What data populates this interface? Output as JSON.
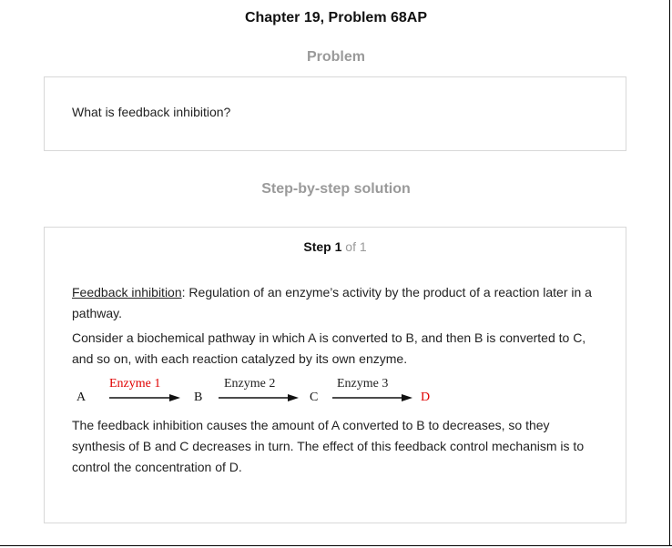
{
  "header": {
    "title": "Chapter 19, Problem 68AP"
  },
  "problem": {
    "heading": "Problem",
    "text": "What is feedback inhibition?"
  },
  "solution": {
    "heading": "Step-by-step solution",
    "step": {
      "word": "Step",
      "number": "1",
      "of_text": "of 1"
    },
    "para1": {
      "term": "Feedback inhibition",
      "rest": ": Regulation of an enzyme’s activity by the product of a reaction later in a pathway."
    },
    "para2": "Consider a biochemical pathway in which A is converted to B, and then B is converted to C, and so on, with each reaction catalyzed by its own enzyme.",
    "pathway": {
      "nodes": [
        "A",
        "B",
        "C",
        "D"
      ],
      "enzymes": [
        "Enzyme 1",
        "Enzyme 2",
        "Enzyme 3"
      ],
      "colors": {
        "highlight": "#e00000",
        "normal": "#111111"
      }
    },
    "para3": "The feedback inhibition causes the amount of A converted to B to decreases, so they synthesis of B and C decreases in turn. The effect of this feedback control mechanism is to control the concentration of D."
  }
}
